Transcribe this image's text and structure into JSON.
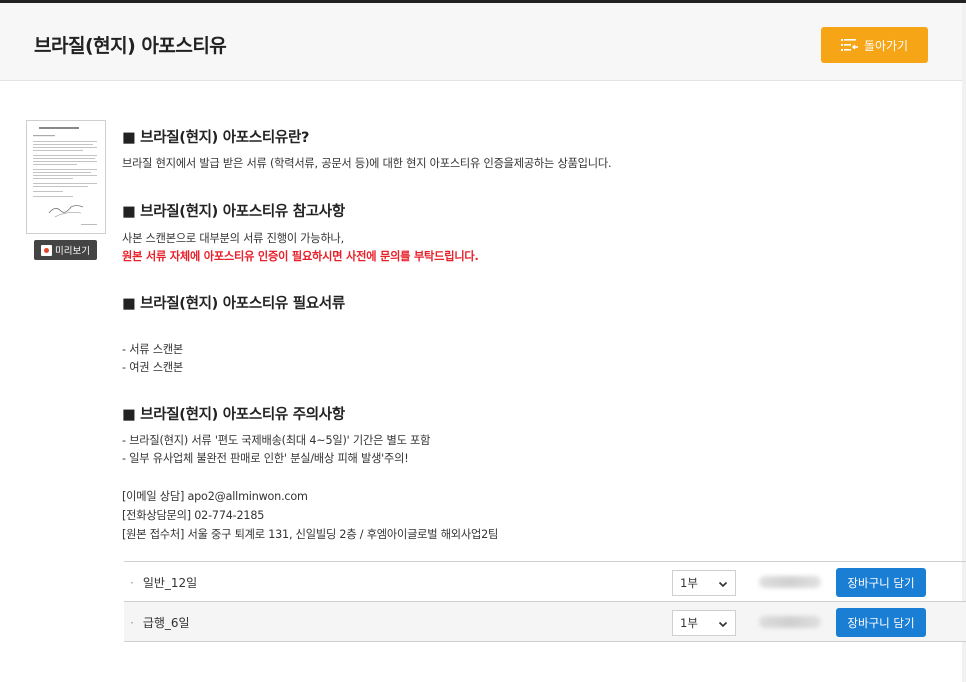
{
  "header": {
    "title": "브라질(현지) 아포스티유",
    "back_label": "돌아가기"
  },
  "thumbnail": {
    "preview_label": "미리보기"
  },
  "sections": {
    "about": {
      "title": "■ 브라질(현지) 아포스티유란?",
      "text": "브라질 현지에서 발급 받은 서류 (학력서류, 공문서 등)에 대한 현지 아포스티유 인증을제공하는 상품입니다."
    },
    "reference": {
      "title": "■ 브라질(현지) 아포스티유 참고사항",
      "text": "사본 스캔본으로 대부분의 서류 진행이 가능하나,",
      "warning": "원본 서류 자체에 아포스티유 인증이 필요하시면 사전에 문의를 부탁드립니다."
    },
    "documents": {
      "title": "■ 브라질(현지) 아포스티유 필요서류",
      "items": [
        "- 서류 스캔본",
        "- 여권 스캔본"
      ]
    },
    "cautions": {
      "title": "■ 브라질(현지) 아포스티유 주의사항",
      "items": [
        "- 브라질(현지) 서류 '편도 국제배송(최대 4~5일)' 기간은 별도 포함",
        "- 일부 유사업체 불완전 판매로 인한' 분실/배상 피해 발생'주의!"
      ]
    },
    "contacts": {
      "email": "[이메일 상담] apo2@allminwon.com",
      "phone": "[전화상담문의] 02-774-2185",
      "address": "[원본 접수처] 서울 중구 퇴계로 131, 신일빌딩 2층 / 후엠아이글로벌 해외사업2팀"
    }
  },
  "options": [
    {
      "bullet": "·",
      "name": "일반_12일",
      "quantity": "1부",
      "cart_label": "장바구니 담기"
    },
    {
      "bullet": "·",
      "name": "급행_6일",
      "quantity": "1부",
      "cart_label": "장바구니 담기"
    }
  ],
  "colors": {
    "back_button": "#f5a516",
    "cart_button": "#1a7fd4",
    "warning_text": "#e8202a"
  }
}
